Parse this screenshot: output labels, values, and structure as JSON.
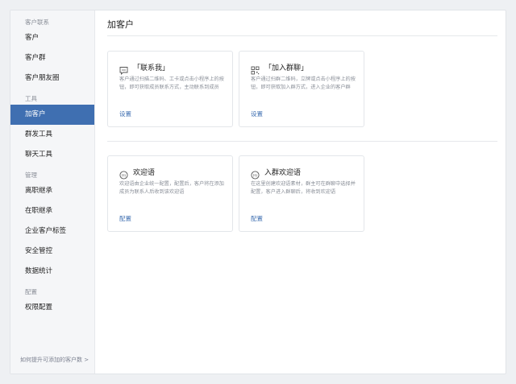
{
  "sidebar": {
    "groups": [
      {
        "title": "客户联系",
        "items": [
          "客户",
          "客户群",
          "客户朋友圈"
        ]
      },
      {
        "title": "工具",
        "items": [
          "加客户",
          "群发工具",
          "聊天工具"
        ]
      },
      {
        "title": "管理",
        "items": [
          "离职继承",
          "在职继承",
          "企业客户标签",
          "安全管控",
          "数据统计"
        ]
      },
      {
        "title": "配置",
        "items": [
          "权限配置"
        ]
      }
    ],
    "active_item": "加客户",
    "footer": "如何提升可添加的客户数 >"
  },
  "main": {
    "title": "加客户",
    "cards": [
      {
        "title": "「联系我」",
        "icon": "chat-icon",
        "desc": "客户通过扫描二维码、工卡或点击小程序上的按钮，即可获取成员联系方式，主动联系到成员",
        "action": "设置"
      },
      {
        "title": "「加入群聊」",
        "icon": "qrcode-icon",
        "desc": "客户通过扫群二维码，立牌或点击小程序上的按钮，即可获取加入群方式，进入企业的客户群",
        "action": "设置"
      },
      {
        "title": "欢迎语",
        "icon": "hi-icon",
        "desc": "欢迎语由企业统一配置，配置后，客户将在添加成员为联系人后收到该欢迎语",
        "action": "配置"
      },
      {
        "title": "入群欢迎语",
        "icon": "hi-icon",
        "desc": "在这里创建欢迎语素材，群主可在群聊中选择并配置，客户进入群聊后，将收到欢迎语",
        "action": "配置"
      }
    ]
  },
  "colors": {
    "accent": "#3f6fb1",
    "sidebar_bg": "#f5f6f8"
  }
}
